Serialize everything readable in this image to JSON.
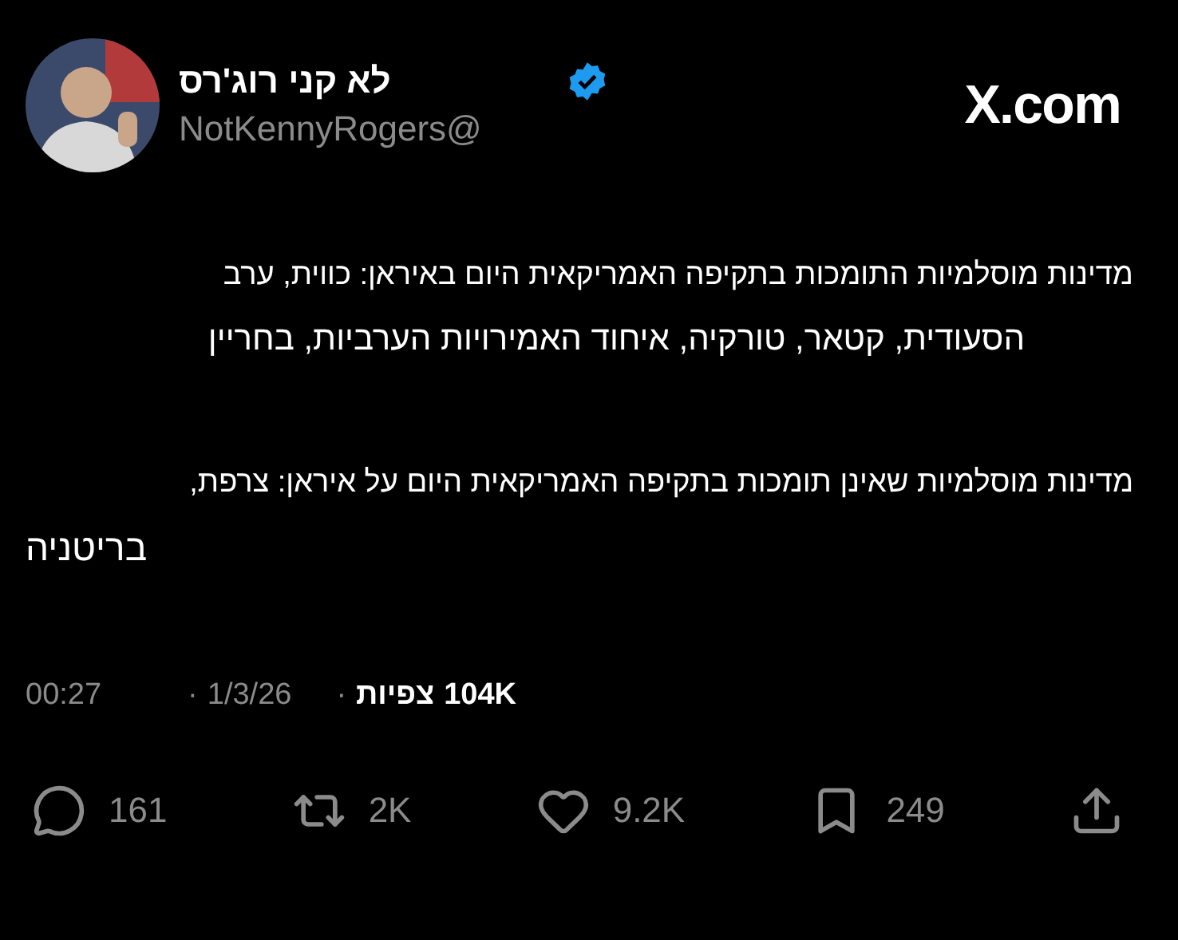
{
  "author": {
    "name": "לא קני רוג'רס",
    "verified": true,
    "handle": "NotKennyRogers@"
  },
  "site": "X.com",
  "paragraphs": [
    {
      "lines": [
        "מדינות מוסלמיות התומכות בתקיפה האמריקאית היום באיראן: כווית, ערב",
        "הסעודית, קטאר, טורקיה, איחוד האמירויות הערביות, בחריין"
      ]
    },
    {
      "lines": [
        "מדינות מוסלמיות שאינן תומכות בתקיפה האמריקאית היום על איראן: צרפת,",
        "בריטניה"
      ]
    }
  ],
  "meta": {
    "time": "00:27",
    "separator_1": "·",
    "date": "1/3/26",
    "separator_2": "·",
    "views_label": "צפיות",
    "views": "104K"
  },
  "actions": [
    {
      "kind": "share"
    },
    {
      "kind": "bookmark",
      "count": "249"
    },
    {
      "kind": "like",
      "count": "9.2K"
    },
    {
      "kind": "repost",
      "count": "2K"
    },
    {
      "kind": "reply",
      "count": "161"
    }
  ]
}
